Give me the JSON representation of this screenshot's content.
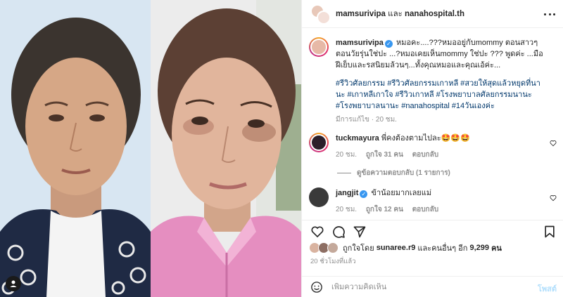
{
  "header": {
    "user1": "mamsurivipa",
    "joiner": "และ",
    "user2": "nanahospital.th"
  },
  "caption": {
    "username": "mamsurivipa",
    "text": "หมอคะ....???หมออยู่กับmommy ตอนสาวๆ ตอนวัยรุ่นใช่ปะ ...?หมอเคยเห็นmommy ใช่ปะ ??? พูดค่ะ ...มือ ฝีเย็บและรสนิยมล้วนๆ...ทั้งคุณหมอและคุณเอ้ค่ะ...",
    "hashtags": "#รีวิวศัลยกรรม #รีวิวศัลยกรรมเกาหลี #สวยให้สุดแล้วหยุดที่นานะ #เกาหลีเกาใจ #รีวิวเกาหลี #โรงพยาบาลศัลยกรรมนานะ #โรงพยาบาลนานะ #nanahospital #14วันเองค่ะ",
    "meta": "มีการแก้ไข · 20 ชม."
  },
  "comments": [
    {
      "username": "tuckmayura",
      "text": "พี่คงต้องตามไปละ🤩🤩🤩",
      "time": "20 ชม.",
      "likes": "ถูกใจ 31 คน",
      "reply": "ตอบกลับ"
    },
    {
      "username": "jangjit",
      "text": "ข้าน้อยมากเลยแม่",
      "time": "20 ชม.",
      "likes": "ถูกใจ 12 คน",
      "reply": "ตอบกลับ"
    }
  ],
  "view_replies": "ดูข้อความตอบกลับ (1 รายการ)",
  "likes": {
    "prefix": "ถูกใจโดย",
    "user": "sunaree.r9",
    "middle": "และคนอื่นๆ อีก",
    "count": "9,299",
    "suffix": "คน"
  },
  "post_time": "20 ชั่วโมงที่แล้ว",
  "composer": {
    "placeholder": "เพิ่มความคิดเห็น",
    "post_label": "โพสต์"
  },
  "colors": {
    "link": "#00376b",
    "verified": "#3897f0",
    "muted": "#8e8e8e",
    "post_disabled": "#b2dffc"
  }
}
